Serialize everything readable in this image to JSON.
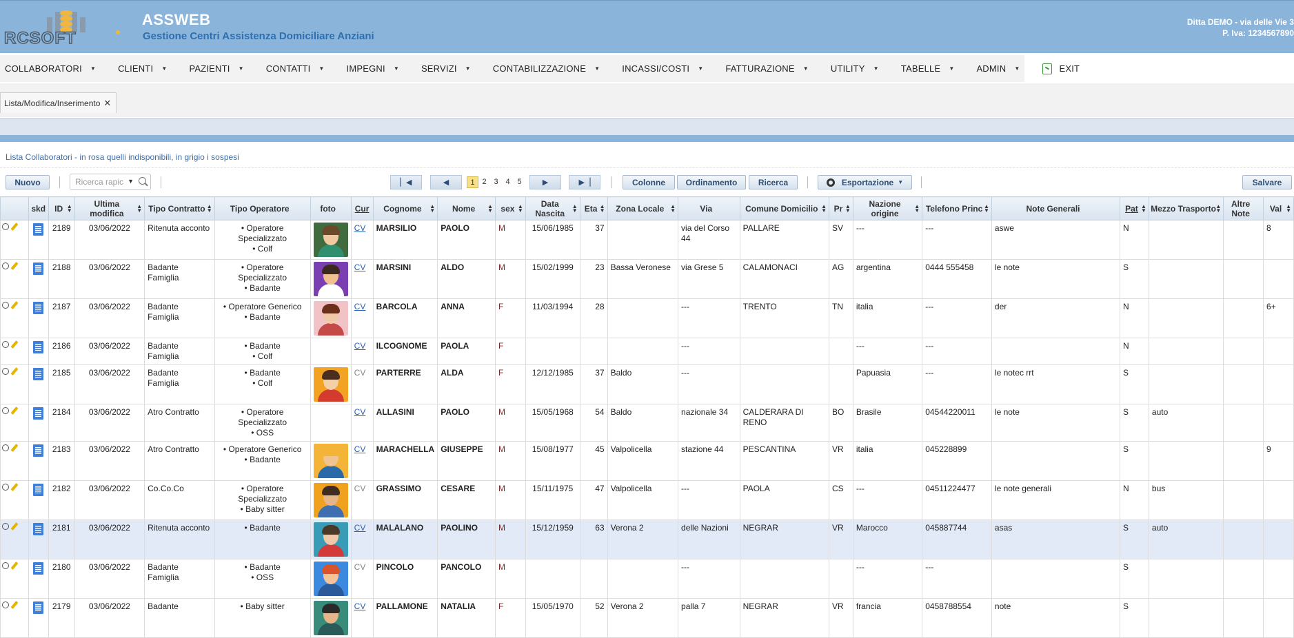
{
  "header": {
    "app_title": "ASSWEB",
    "app_subtitle": "Gestione Centri Assistenza Domiciliare Anziani",
    "logo_text": "RCSOFT",
    "company_line1": "Ditta DEMO - via delle Vie 3",
    "company_line2": "P. Iva: 1234567890"
  },
  "menu": [
    {
      "label": "COLLABORATORI"
    },
    {
      "label": "CLIENTI"
    },
    {
      "label": "PAZIENTI"
    },
    {
      "label": "CONTATTI"
    },
    {
      "label": "IMPEGNI"
    },
    {
      "label": "SERVIZI"
    },
    {
      "label": "CONTABILIZZAZIONE"
    },
    {
      "label": "INCASSI/COSTI"
    },
    {
      "label": "FATTURAZIONE"
    },
    {
      "label": "UTILITY"
    },
    {
      "label": "TABELLE"
    },
    {
      "label": "ADMIN"
    }
  ],
  "exit_label": "EXIT",
  "tab": {
    "label": "Lista/Modifica/Inserimento",
    "close": "✕"
  },
  "caption": "Lista Collaboratori - in rosa quelli indisponibili, in grigio i sospesi",
  "toolbar": {
    "new_label": "Nuovo",
    "search_placeholder": "Ricerca rapic",
    "pages": [
      "1",
      "2",
      "3",
      "4",
      "5"
    ],
    "current_page": "1",
    "columns_label": "Colonne",
    "order_label": "Ordinamento",
    "search_label": "Ricerca",
    "export_label": "Esportazione",
    "save_label": "Salvare"
  },
  "columns": [
    {
      "label": "",
      "width": 0
    },
    {
      "label": "skd"
    },
    {
      "label": "ID"
    },
    {
      "label": "Ultima modifica"
    },
    {
      "label": "Tipo Contratto"
    },
    {
      "label": "Tipo Operatore"
    },
    {
      "label": "foto"
    },
    {
      "label": "Cur"
    },
    {
      "label": "Cognome"
    },
    {
      "label": "Nome"
    },
    {
      "label": "sex"
    },
    {
      "label": "Data Nascita"
    },
    {
      "label": "Eta"
    },
    {
      "label": "Zona Locale"
    },
    {
      "label": "Via"
    },
    {
      "label": "Comune Domicilio"
    },
    {
      "label": "Pr"
    },
    {
      "label": "Nazione origine"
    },
    {
      "label": "Telefono Princ"
    },
    {
      "label": "Note Generali"
    },
    {
      "label": "Pat"
    },
    {
      "label": "Mezzo Trasporto"
    },
    {
      "label": "Altre Note"
    },
    {
      "label": "Val"
    }
  ],
  "rows": [
    {
      "id": "2189",
      "mod": "03/06/2022",
      "contratto": "Ritenuta acconto",
      "operatore": [
        "Operatore Specializzato",
        "Colf"
      ],
      "foto": "green",
      "cv": "CV",
      "cv_link": true,
      "cognome": "MARSILIO",
      "nome": "PAOLO",
      "sex": "M",
      "nascita": "15/06/1985",
      "eta": "37",
      "zona": "",
      "via": "via del Corso 44",
      "comune": "PALLARE",
      "pr": "SV",
      "nazione": "---",
      "tel": "---",
      "note": "aswe",
      "pat": "N",
      "mezzo": "",
      "altre": "",
      "val": "8",
      "state": "normal"
    },
    {
      "id": "2188",
      "mod": "03/06/2022",
      "contratto": "Badante Famiglia",
      "operatore": [
        "Operatore Specializzato",
        "Badante"
      ],
      "foto": "purple",
      "cv": "CV",
      "cv_link": true,
      "cognome": "MARSINI",
      "nome": "ALDO",
      "sex": "M",
      "nascita": "15/02/1999",
      "eta": "23",
      "zona": "Bassa Veronese",
      "via": "via Grese 5",
      "comune": "CALAMONACI",
      "pr": "AG",
      "nazione": "argentina",
      "tel": "0444 555458",
      "note": "le note",
      "pat": "S",
      "mezzo": "",
      "altre": "",
      "val": "",
      "state": "normal"
    },
    {
      "id": "2187",
      "mod": "03/06/2022",
      "contratto": "Badante Famiglia",
      "operatore": [
        "Operatore Generico",
        "Badante"
      ],
      "foto": "pink",
      "cv": "CV",
      "cv_link": true,
      "cognome": "BARCOLA",
      "nome": "ANNA",
      "sex": "F",
      "nascita": "11/03/1994",
      "eta": "28",
      "zona": "",
      "via": "---",
      "comune": "TRENTO",
      "pr": "TN",
      "nazione": "italia",
      "tel": "---",
      "note": "der",
      "pat": "N",
      "mezzo": "",
      "altre": "",
      "val": "6+",
      "state": "normal"
    },
    {
      "id": "2186",
      "mod": "03/06/2022",
      "contratto": "Badante Famiglia",
      "operatore": [
        "Badante",
        "Colf"
      ],
      "foto": "",
      "cv": "CV",
      "cv_link": true,
      "cognome": "ILCOGNOME",
      "nome": "PAOLA",
      "sex": "F",
      "nascita": "",
      "eta": "",
      "zona": "",
      "via": "---",
      "comune": "",
      "pr": "",
      "nazione": "---",
      "tel": "---",
      "note": "",
      "pat": "N",
      "mezzo": "",
      "altre": "",
      "val": "",
      "state": "normal"
    },
    {
      "id": "2185",
      "mod": "03/06/2022",
      "contratto": "Badante Famiglia",
      "operatore": [
        "Badante",
        "Colf"
      ],
      "foto": "orange",
      "cv": "CV",
      "cv_link": false,
      "cognome": "PARTERRE",
      "nome": "ALDA",
      "sex": "F",
      "nascita": "12/12/1985",
      "eta": "37",
      "zona": "Baldo",
      "via": "---",
      "comune": "",
      "pr": "",
      "nazione": "Papuasia",
      "tel": "---",
      "note": "le notec rrt",
      "pat": "S",
      "mezzo": "",
      "altre": "",
      "val": "",
      "state": "normal"
    },
    {
      "id": "2184",
      "mod": "03/06/2022",
      "contratto": "Atro Contratto",
      "operatore": [
        "Operatore Specializzato",
        "OSS"
      ],
      "foto": "",
      "cv": "CV",
      "cv_link": true,
      "cognome": "ALLASINI",
      "nome": "PAOLO",
      "sex": "M",
      "nascita": "15/05/1968",
      "eta": "54",
      "zona": "Baldo",
      "via": "nazionale 34",
      "comune": "CALDERARA DI RENO",
      "pr": "BO",
      "nazione": "Brasile",
      "tel": "04544220011",
      "note": "le note",
      "pat": "S",
      "mezzo": "auto",
      "altre": "",
      "val": "",
      "state": "unavailable"
    },
    {
      "id": "2183",
      "mod": "03/06/2022",
      "contratto": "Atro Contratto",
      "operatore": [
        "Operatore Generico",
        "Badante"
      ],
      "foto": "yellow",
      "cv": "CV",
      "cv_link": true,
      "cognome": "MARACHELLA",
      "nome": "GIUSEPPE",
      "sex": "M",
      "nascita": "15/08/1977",
      "eta": "45",
      "zona": "Valpolicella",
      "via": "stazione 44",
      "comune": "PESCANTINA",
      "pr": "VR",
      "nazione": "italia",
      "tel": "045228899",
      "note": "",
      "pat": "S",
      "mezzo": "",
      "altre": "",
      "val": "9",
      "state": "normal"
    },
    {
      "id": "2182",
      "mod": "03/06/2022",
      "contratto": "Co.Co.Co",
      "operatore": [
        "Operatore Specializzato",
        "Baby sitter"
      ],
      "foto": "amber",
      "cv": "CV",
      "cv_link": false,
      "cognome": "GRASSIMO",
      "nome": "CESARE",
      "sex": "M",
      "nascita": "15/11/1975",
      "eta": "47",
      "zona": "Valpolicella",
      "via": "---",
      "comune": "PAOLA",
      "pr": "CS",
      "nazione": "---",
      "tel": "04511224477",
      "note": "le note generali",
      "pat": "N",
      "mezzo": "bus",
      "altre": "",
      "val": "",
      "state": "normal"
    },
    {
      "id": "2181",
      "mod": "03/06/2022",
      "contratto": "Ritenuta acconto",
      "operatore": [
        "Badante"
      ],
      "foto": "teal",
      "cv": "CV",
      "cv_link": true,
      "cognome": "MALALANO",
      "nome": "PAOLINO",
      "sex": "M",
      "nascita": "15/12/1959",
      "eta": "63",
      "zona": "Verona 2",
      "via": "delle Nazioni",
      "comune": "NEGRAR",
      "pr": "VR",
      "nazione": "Marocco",
      "tel": "045887744",
      "note": "asas",
      "pat": "S",
      "mezzo": "auto",
      "altre": "",
      "val": "",
      "state": "selected"
    },
    {
      "id": "2180",
      "mod": "03/06/2022",
      "contratto": "Badante Famiglia",
      "operatore": [
        "Badante",
        "OSS"
      ],
      "foto": "blue",
      "cv": "CV",
      "cv_link": false,
      "cognome": "PINCOLO",
      "nome": "PANCOLO",
      "sex": "M",
      "nascita": "",
      "eta": "",
      "zona": "",
      "via": "---",
      "comune": "",
      "pr": "",
      "nazione": "---",
      "tel": "---",
      "note": "",
      "pat": "S",
      "mezzo": "",
      "altre": "",
      "val": "",
      "state": "suspended"
    },
    {
      "id": "2179",
      "mod": "03/06/2022",
      "contratto": "Badante",
      "operatore": [
        "Baby sitter"
      ],
      "foto": "teal2",
      "cv": "CV",
      "cv_link": true,
      "cognome": "PALLAMONE",
      "nome": "NATALIA",
      "sex": "F",
      "nascita": "15/05/1970",
      "eta": "52",
      "zona": "Verona 2",
      "via": "palla 7",
      "comune": "NEGRAR",
      "pr": "VR",
      "nazione": "francia",
      "tel": "0458788554",
      "note": "note",
      "pat": "S",
      "mezzo": "",
      "altre": "",
      "val": "",
      "state": "normal"
    }
  ]
}
